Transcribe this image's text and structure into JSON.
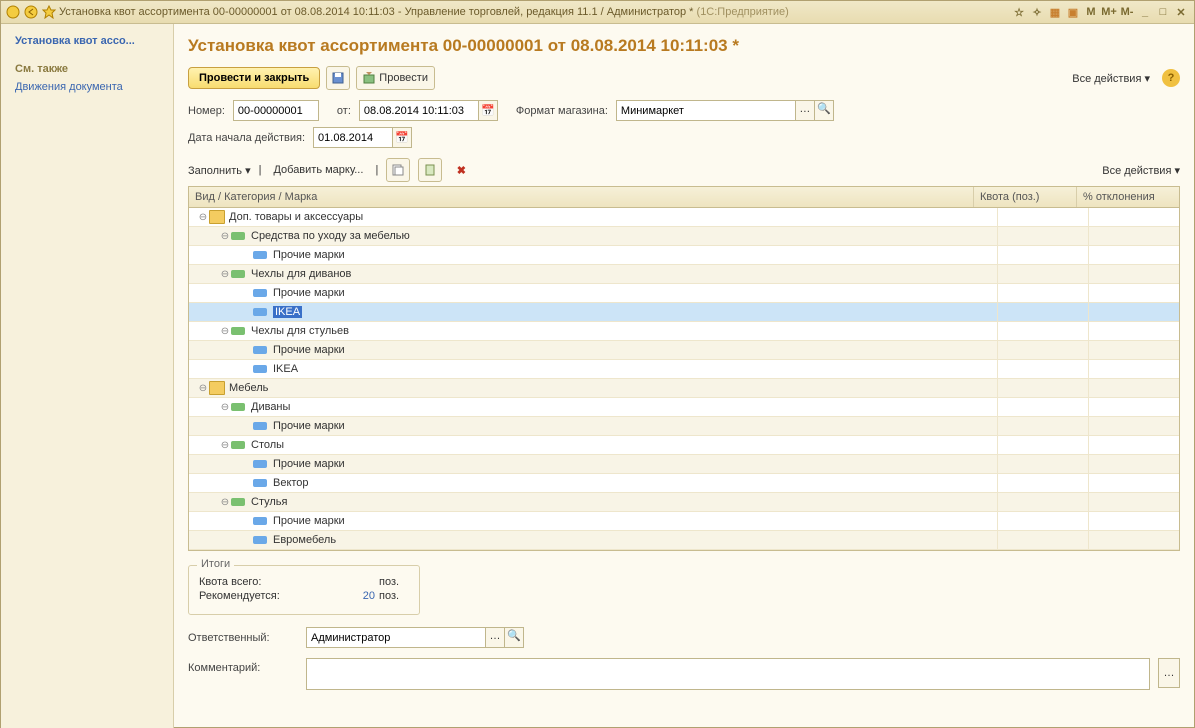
{
  "titlebar": {
    "title_main": "Установка квот ассортимента 00-00000001 от 08.08.2014 10:11:03 - Управление торговлей, редакция 11.1 / Администратор *",
    "title_suffix": "(1С:Предприятие)",
    "m": "M",
    "mplus": "M+",
    "mminus": "M-"
  },
  "sidebar": {
    "items": [
      "Установка квот ассо...",
      "См. также",
      "Движения документа"
    ]
  },
  "header": {
    "title": "Установка квот ассортимента 00-00000001 от 08.08.2014 10:11:03 *"
  },
  "toolbar1": {
    "post_close": "Провести и закрыть",
    "post": "Провести",
    "all_actions": "Все действия"
  },
  "form": {
    "number_label": "Номер:",
    "number_value": "00-00000001",
    "from_label": "от:",
    "from_value": "08.08.2014 10:11:03",
    "format_label": "Формат магазина:",
    "format_value": "Минимаркет",
    "start_label": "Дата начала действия:",
    "start_value": "01.08.2014"
  },
  "toolbar2": {
    "fill": "Заполнить",
    "add_brand": "Добавить марку...",
    "all_actions": "Все действия"
  },
  "grid": {
    "h1": "Вид / Категория / Марка",
    "h2": "Квота (поз.)",
    "h3": "% отклонения",
    "rows": [
      {
        "lvl": 0,
        "type": "folder",
        "toggle": "-",
        "text": "Доп. товары и аксессуары"
      },
      {
        "lvl": 1,
        "type": "cat",
        "toggle": "-",
        "text": "Средства по уходу за мебелью",
        "alt": true
      },
      {
        "lvl": 2,
        "type": "brand",
        "text": "Прочие марки"
      },
      {
        "lvl": 1,
        "type": "cat",
        "toggle": "-",
        "text": "Чехлы для диванов",
        "alt": true
      },
      {
        "lvl": 2,
        "type": "brand",
        "text": "Прочие марки"
      },
      {
        "lvl": 2,
        "type": "brand",
        "text": "IKEA",
        "sel": true,
        "alt": true
      },
      {
        "lvl": 1,
        "type": "cat",
        "toggle": "-",
        "text": "Чехлы для стульев"
      },
      {
        "lvl": 2,
        "type": "brand",
        "text": "Прочие марки",
        "alt": true
      },
      {
        "lvl": 2,
        "type": "brand",
        "text": "IKEA"
      },
      {
        "lvl": 0,
        "type": "folder",
        "toggle": "-",
        "text": "Мебель",
        "alt": true
      },
      {
        "lvl": 1,
        "type": "cat",
        "toggle": "-",
        "text": "Диваны"
      },
      {
        "lvl": 2,
        "type": "brand",
        "text": "Прочие марки",
        "alt": true
      },
      {
        "lvl": 1,
        "type": "cat",
        "toggle": "-",
        "text": "Столы"
      },
      {
        "lvl": 2,
        "type": "brand",
        "text": "Прочие марки",
        "alt": true
      },
      {
        "lvl": 2,
        "type": "brand",
        "text": "Вектор"
      },
      {
        "lvl": 1,
        "type": "cat",
        "toggle": "-",
        "text": "Стулья",
        "alt": true
      },
      {
        "lvl": 2,
        "type": "brand",
        "text": "Прочие марки"
      },
      {
        "lvl": 2,
        "type": "brand",
        "text": "Евромебель",
        "alt": true
      }
    ]
  },
  "totals": {
    "legend": "Итоги",
    "quota_label": "Квота всего:",
    "quota_val": "",
    "quota_unit": "поз.",
    "rec_label": "Рекомендуется:",
    "rec_val": "20",
    "rec_unit": "поз."
  },
  "bottom": {
    "responsible_label": "Ответственный:",
    "responsible_value": "Администратор",
    "comment_label": "Комментарий:"
  }
}
